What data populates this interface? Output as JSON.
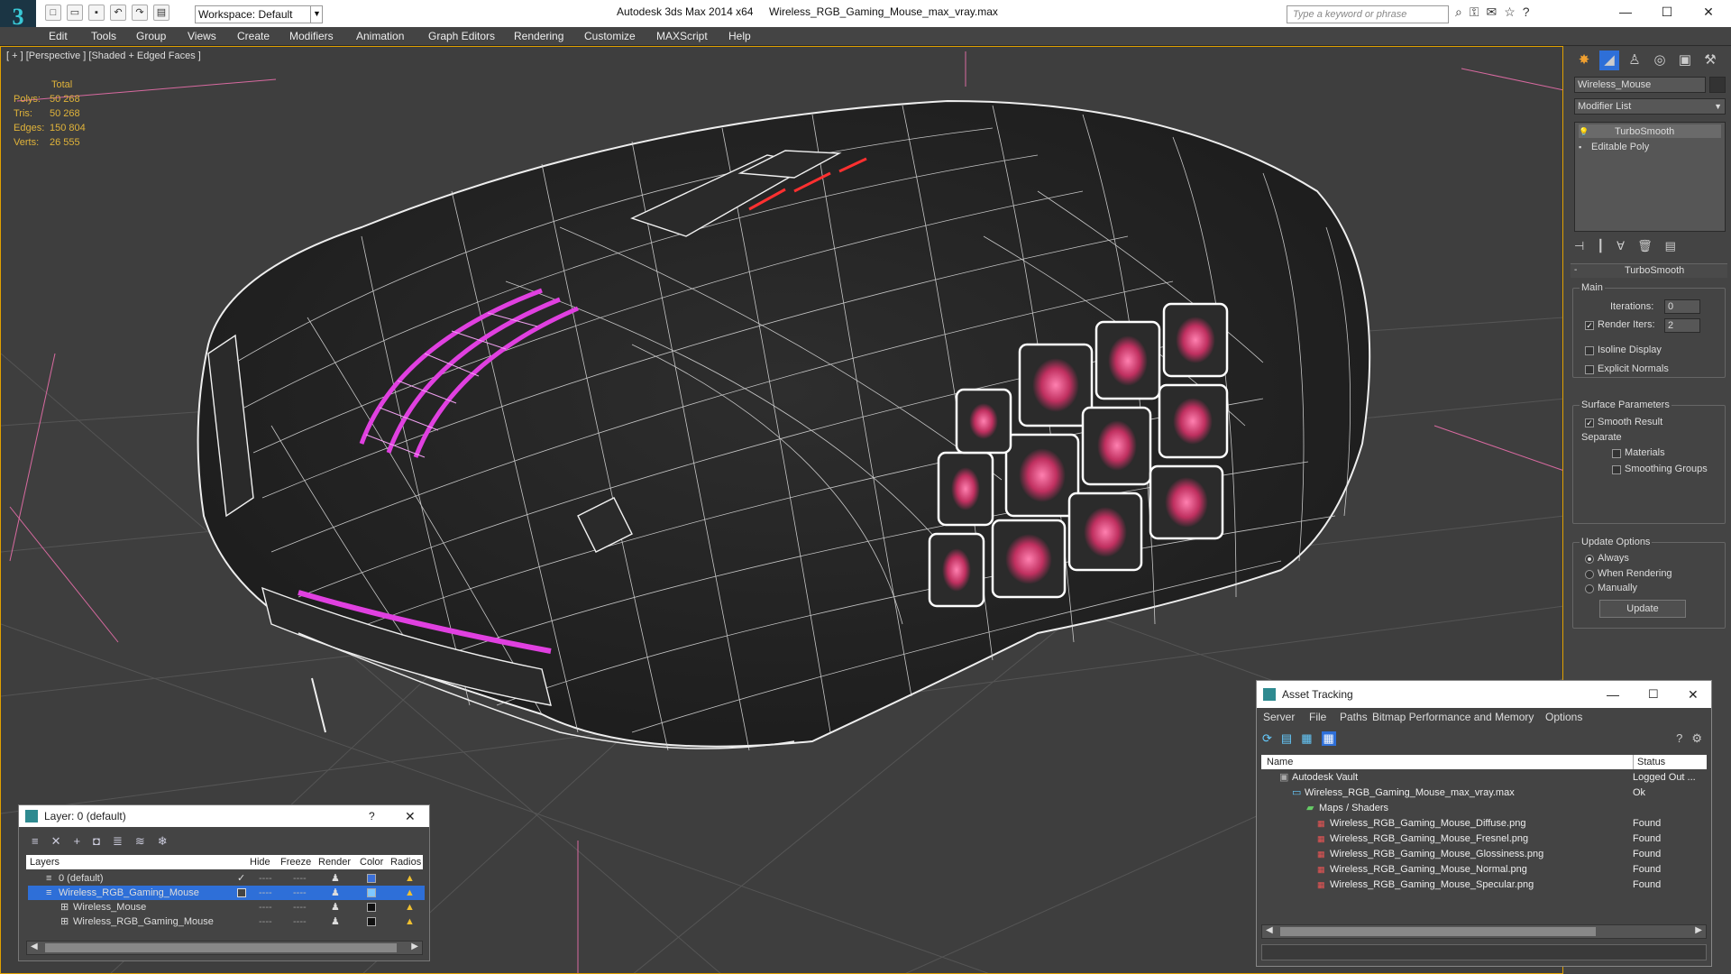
{
  "titlebar": {
    "app_title": "Autodesk 3ds Max  2014 x64",
    "file_title": "Wireless_RGB_Gaming_Mouse_max_vray.max",
    "workspace": "Workspace: Default",
    "search_placeholder": "Type a keyword or phrase"
  },
  "menu": [
    "Edit",
    "Tools",
    "Group",
    "Views",
    "Create",
    "Modifiers",
    "Animation",
    "Graph Editors",
    "Rendering",
    "Customize",
    "MAXScript",
    "Help"
  ],
  "viewport": {
    "label": "[ + ] [Perspective ] [Shaded + Edged Faces ]",
    "stats": {
      "header": "Total",
      "rows": [
        {
          "label": "Polys:",
          "value": "50 268"
        },
        {
          "label": "Tris:",
          "value": "50 268"
        },
        {
          "label": "Edges:",
          "value": "150 804"
        },
        {
          "label": "Verts:",
          "value": "26 555"
        }
      ]
    }
  },
  "command_panel": {
    "object_name": "Wireless_Mouse",
    "modifier_list": "Modifier List",
    "stack": [
      "TurboSmooth",
      "Editable Poly"
    ],
    "rollout_title": "TurboSmooth",
    "main_label": "Main",
    "iterations_label": "Iterations:",
    "iterations_value": "0",
    "render_iters_label": "Render Iters:",
    "render_iters_value": "2",
    "isoline": "Isoline Display",
    "explicit": "Explicit Normals",
    "surface_params": "Surface Parameters",
    "smooth_result": "Smooth Result",
    "separate": "Separate",
    "materials": "Materials",
    "smoothing_groups": "Smoothing Groups",
    "update_options": "Update Options",
    "always": "Always",
    "when_rendering": "When Rendering",
    "manually": "Manually",
    "update_button": "Update"
  },
  "layer_window": {
    "title": "Layer: 0 (default)",
    "help": "?",
    "columns": [
      "Layers",
      "Hide",
      "Freeze",
      "Render",
      "Color",
      "Radios"
    ],
    "rows": [
      {
        "name": "0 (default)",
        "color": "#3a6fd8"
      },
      {
        "name": "Wireless_RGB_Gaming_Mouse",
        "color": "#7fc7ff"
      },
      {
        "name": "Wireless_Mouse",
        "color": "#111111"
      },
      {
        "name": "Wireless_RGB_Gaming_Mouse",
        "color": "#111111"
      }
    ]
  },
  "asset_window": {
    "title": "Asset Tracking",
    "menu": [
      "Server",
      "File",
      "Paths",
      "Bitmap Performance and Memory",
      "Options"
    ],
    "columns": [
      "Name",
      "Status"
    ],
    "rows": [
      {
        "name": "Autodesk Vault",
        "status": "Logged Out ..."
      },
      {
        "name": "Wireless_RGB_Gaming_Mouse_max_vray.max",
        "status": "Ok"
      },
      {
        "name": "Maps / Shaders",
        "status": ""
      },
      {
        "name": "Wireless_RGB_Gaming_Mouse_Diffuse.png",
        "status": "Found"
      },
      {
        "name": "Wireless_RGB_Gaming_Mouse_Fresnel.png",
        "status": "Found"
      },
      {
        "name": "Wireless_RGB_Gaming_Mouse_Glossiness.png",
        "status": "Found"
      },
      {
        "name": "Wireless_RGB_Gaming_Mouse_Normal.png",
        "status": "Found"
      },
      {
        "name": "Wireless_RGB_Gaming_Mouse_Specular.png",
        "status": "Found"
      }
    ]
  },
  "colors": {
    "accent": "#e040e0",
    "selection": "#2e6fd8",
    "stats": "#e0b33a"
  }
}
